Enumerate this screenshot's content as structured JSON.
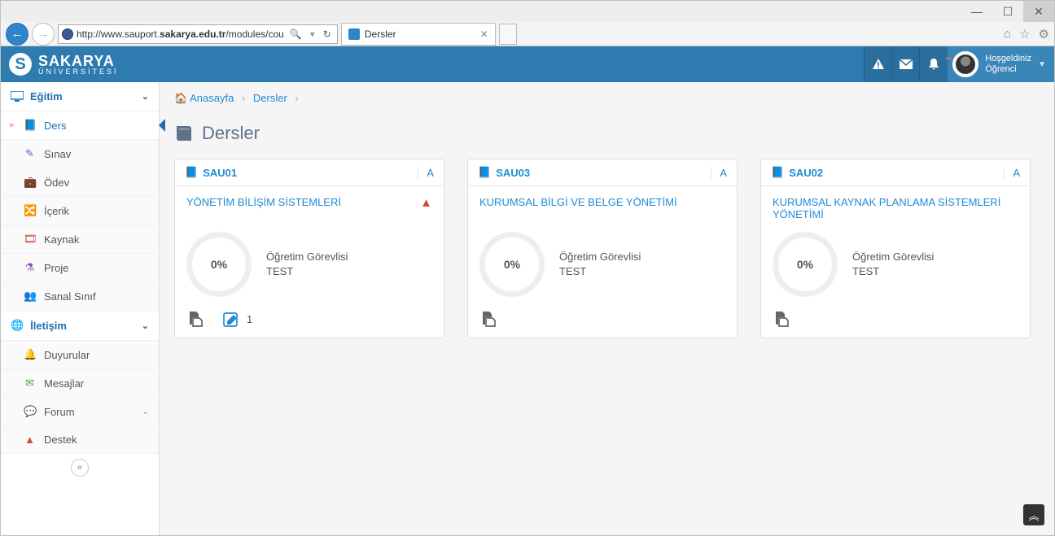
{
  "window": {
    "url_prefix": "http://www.sauport.",
    "url_bold": "sakarya.edu.tr",
    "url_suffix": "/modules/cou",
    "tab_title": "Dersler"
  },
  "brand": {
    "line1": "SAKARYA",
    "line2": "ÜNİVERSİTESİ"
  },
  "user": {
    "greeting": "Hoşgeldiniz",
    "name": "Öğrenci"
  },
  "sidebar": {
    "section1": "Eğitim",
    "section2": "İletişim",
    "items1": [
      {
        "label": "Ders"
      },
      {
        "label": "Sınav"
      },
      {
        "label": "Ödev"
      },
      {
        "label": "İçerik"
      },
      {
        "label": "Kaynak"
      },
      {
        "label": "Proje"
      },
      {
        "label": "Sanal Sınıf"
      }
    ],
    "items2": [
      {
        "label": "Duyurular"
      },
      {
        "label": "Mesajlar"
      },
      {
        "label": "Forum"
      },
      {
        "label": "Destek"
      }
    ]
  },
  "breadcrumbs": {
    "home": "Anasayfa",
    "current": "Dersler"
  },
  "page_title": "Dersler",
  "courses": [
    {
      "code": "SAU01",
      "tag": "A",
      "title": "YÖNETİM BİLİŞİM SİSTEMLERİ",
      "warning": true,
      "percent": "0%",
      "instructor_role": "Öğretim Görevlisi",
      "instructor_name": "TEST",
      "edit_count": "1"
    },
    {
      "code": "SAU03",
      "tag": "A",
      "title": "KURUMSAL BİLGİ VE BELGE YÖNETİMİ",
      "warning": false,
      "percent": "0%",
      "instructor_role": "Öğretim Görevlisi",
      "instructor_name": "TEST",
      "edit_count": ""
    },
    {
      "code": "SAU02",
      "tag": "A",
      "title": "KURUMSAL KAYNAK PLANLAMA SİSTEMLERİ YÖNETİMİ",
      "warning": false,
      "percent": "0%",
      "instructor_role": "Öğretim Görevlisi",
      "instructor_name": "TEST",
      "edit_count": ""
    }
  ]
}
